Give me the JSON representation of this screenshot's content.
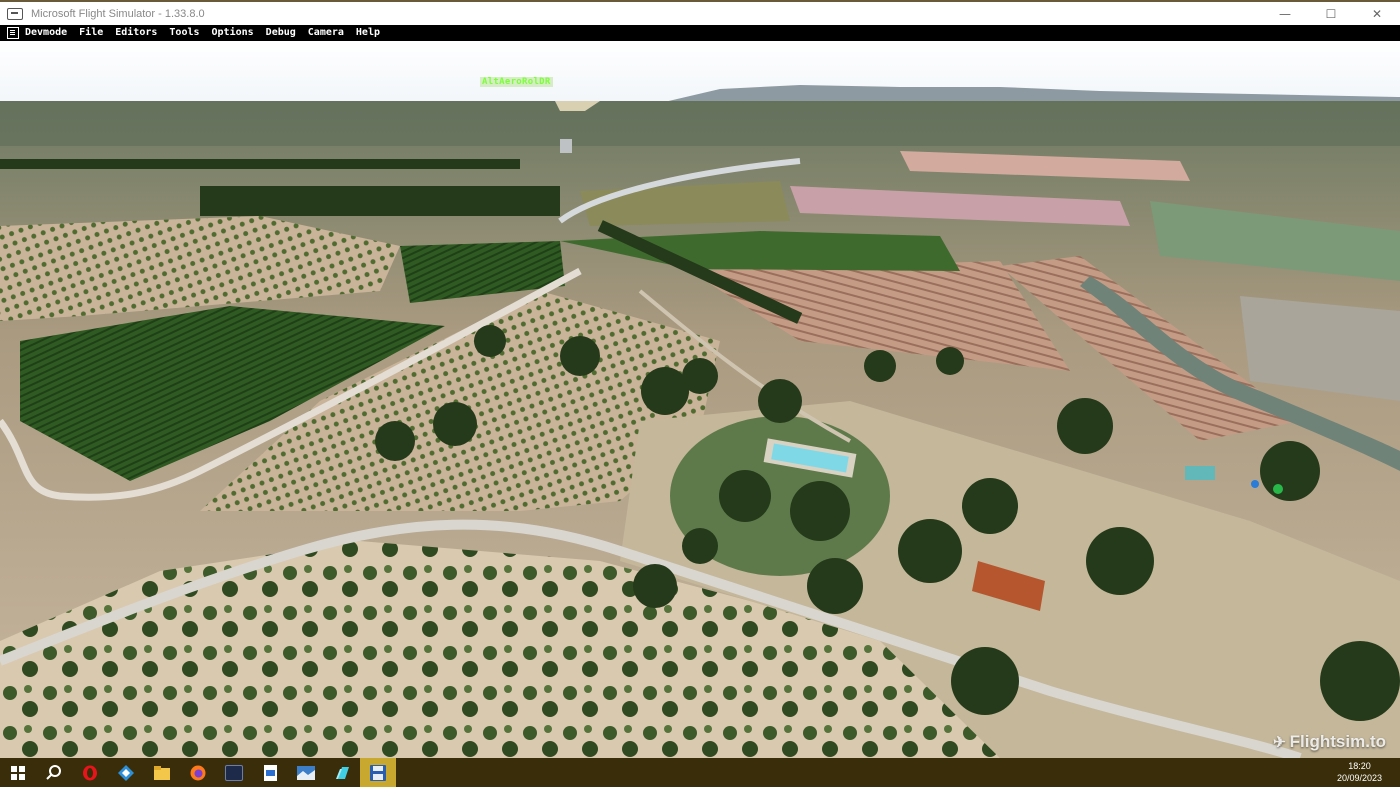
{
  "window": {
    "title": "Microsoft Flight Simulator - 1.33.8.0",
    "controls": {
      "minimize": "—",
      "maximize": "☐",
      "close": "✕"
    }
  },
  "menubar": {
    "icon": "devmode-icon",
    "items": [
      "Devmode",
      "File",
      "Editors",
      "Tools",
      "Options",
      "Debug",
      "Camera",
      "Help"
    ]
  },
  "scene": {
    "hud_text": "AltAeroRolDR",
    "watermark": "Flightsim.to",
    "description_icon": "aerial-landscape"
  },
  "taskbar": {
    "buttons": [
      {
        "name": "start",
        "icon": "windows-icon",
        "active": false
      },
      {
        "name": "search",
        "icon": "search-icon",
        "active": false
      },
      {
        "name": "opera",
        "icon": "opera-icon",
        "active": false
      },
      {
        "name": "app-blue",
        "icon": "app-blue-icon",
        "active": false
      },
      {
        "name": "file-explorer",
        "icon": "folder-icon",
        "active": false
      },
      {
        "name": "firefox",
        "icon": "firefox-icon",
        "active": false
      },
      {
        "name": "app-dark",
        "icon": "app-dark-icon",
        "active": false
      },
      {
        "name": "document",
        "icon": "document-icon",
        "active": false
      },
      {
        "name": "photos",
        "icon": "photos-icon",
        "active": false
      },
      {
        "name": "app-cyan",
        "icon": "app-cyan-icon",
        "active": false
      },
      {
        "name": "flight-simulator",
        "icon": "floppy-disk-icon",
        "active": true
      }
    ],
    "clock": {
      "time": "18:20",
      "date": "20/09/2023"
    }
  },
  "colors": {
    "taskbar": "#3a2e0a",
    "taskbar_active": "#c9a830",
    "menubar": "#000000",
    "hud": "#7cff3a"
  }
}
